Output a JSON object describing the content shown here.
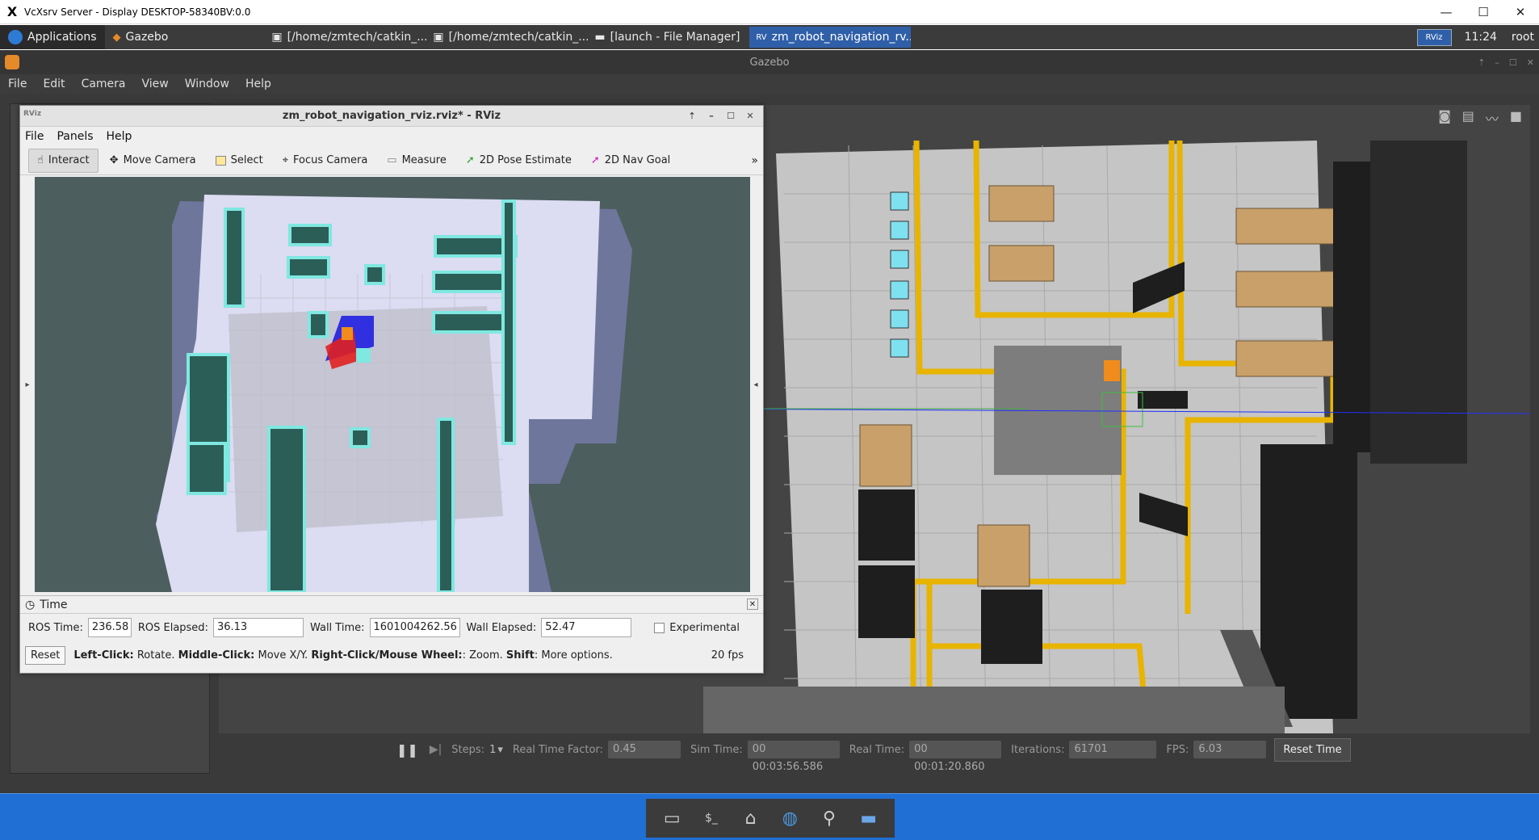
{
  "xserver": {
    "title": "VcXsrv Server - Display DESKTOP-58340BV:0.0",
    "logo": "X",
    "minimize_icon": "—",
    "maximize_icon": "☐",
    "close_icon": "✕"
  },
  "panel": {
    "applications": "Applications",
    "gazebo": "Gazebo",
    "tasks": [
      {
        "label": "[/home/zmtech/catkin_...",
        "active": false
      },
      {
        "label": "[/home/zmtech/catkin_...",
        "active": false
      },
      {
        "label": "[launch - File Manager]",
        "active": false
      },
      {
        "label": "zm_robot_navigation_rv...",
        "active": true
      }
    ],
    "rviz_badge": "RViz",
    "clock": "11:24",
    "user": "root"
  },
  "gazebo": {
    "title": "Gazebo",
    "menu": [
      "File",
      "Edit",
      "Camera",
      "View",
      "Window",
      "Help"
    ],
    "bottom": {
      "steps_label": "Steps:",
      "steps_value": "1",
      "rtf_label": "Real Time Factor:",
      "rtf_value": "0.45",
      "sim_time_label": "Sim Time:",
      "sim_time_value": "00 00:03:56.586",
      "real_time_label": "Real Time:",
      "real_time_value": "00 00:01:20.860",
      "iterations_label": "Iterations:",
      "iterations_value": "61701",
      "fps_label": "FPS:",
      "fps_value": "6.03",
      "reset_time": "Reset Time"
    }
  },
  "rviz": {
    "title": "zm_robot_navigation_rviz.rviz* - RViz",
    "logo": "RViz",
    "menu": [
      "File",
      "Panels",
      "Help"
    ],
    "tools": [
      "Interact",
      "Move Camera",
      "Select",
      "Focus Camera",
      "Measure",
      "2D Pose Estimate",
      "2D Nav Goal"
    ],
    "more": "»",
    "time_panel": {
      "title": "Time",
      "ros_time_label": "ROS Time:",
      "ros_time_value": "236.58",
      "ros_elapsed_label": "ROS Elapsed:",
      "ros_elapsed_value": "36.13",
      "wall_time_label": "Wall Time:",
      "wall_time_value": "1601004262.56",
      "wall_elapsed_label": "Wall Elapsed:",
      "wall_elapsed_value": "52.47",
      "experimental_label": "Experimental",
      "reset": "Reset",
      "help_parts": [
        "Left-Click:",
        " Rotate. ",
        "Middle-Click:",
        " Move X/Y. ",
        "Right-Click/Mouse Wheel:",
        ": Zoom. ",
        "Shift",
        ": More options."
      ],
      "fps": "20 fps"
    }
  }
}
